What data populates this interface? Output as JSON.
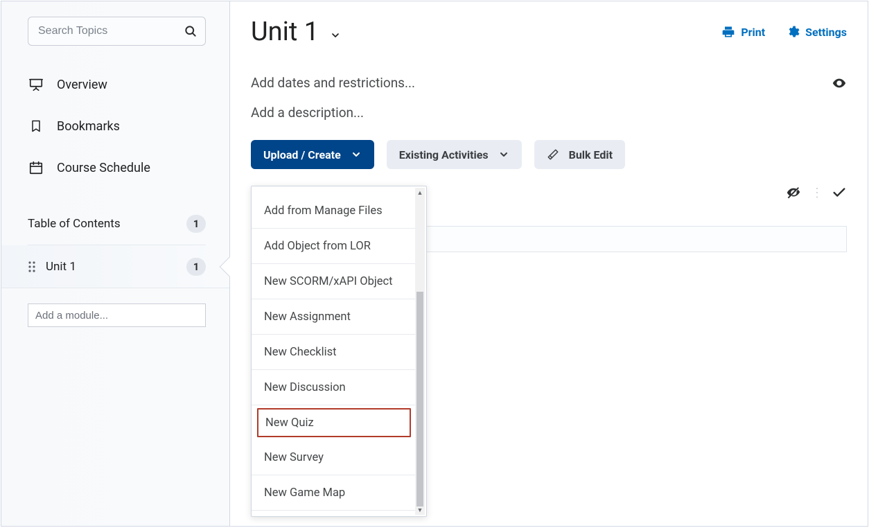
{
  "sidebar": {
    "search_placeholder": "Search Topics",
    "nav": [
      {
        "label": "Overview"
      },
      {
        "label": "Bookmarks"
      },
      {
        "label": "Course Schedule"
      }
    ],
    "toc": {
      "label": "Table of Contents",
      "count": "1"
    },
    "modules": [
      {
        "label": "Unit 1",
        "count": "1"
      }
    ],
    "add_module_placeholder": "Add a module..."
  },
  "header": {
    "title": "Unit 1",
    "print_label": "Print",
    "settings_label": "Settings"
  },
  "meta": {
    "dates_label": "Add dates and restrictions...",
    "description_label": "Add a description..."
  },
  "toolbar": {
    "upload_create_label": "Upload / Create",
    "existing_activities_label": "Existing Activities",
    "bulk_edit_label": "Bulk Edit"
  },
  "dropdown": {
    "items": [
      "Add from Manage Files",
      "Add Object from LOR",
      "New SCORM/xAPI Object",
      "New Assignment",
      "New Checklist",
      "New Discussion",
      "New Quiz",
      "New Survey",
      "New Game Map"
    ],
    "highlighted_index": 6
  }
}
